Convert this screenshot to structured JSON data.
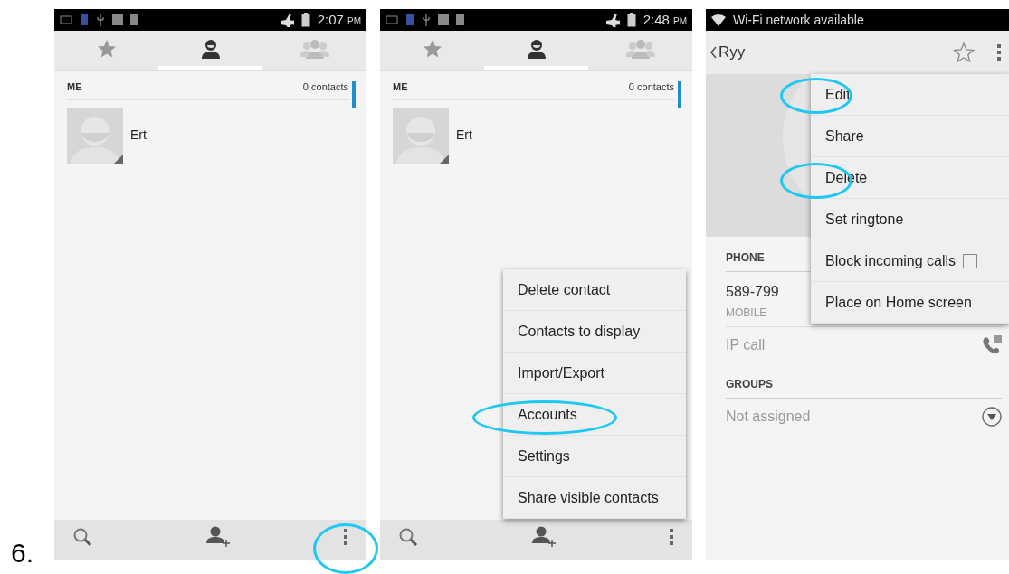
{
  "step_label": "6.",
  "screens": [
    {
      "kind": "contacts",
      "status_bar": {
        "time": "2:07",
        "period": "PM"
      },
      "tabs": [
        {
          "kind": "star",
          "selected": false
        },
        {
          "kind": "person",
          "selected": true
        },
        {
          "kind": "group",
          "selected": false
        }
      ],
      "section": {
        "title": "ME",
        "count": "0 contacts"
      },
      "contacts": [
        {
          "name": "Ert"
        }
      ],
      "bottom_bar": [
        {
          "kind": "search",
          "highlighted": false
        },
        {
          "kind": "add_contact",
          "highlighted": false
        },
        {
          "kind": "more",
          "highlighted": true
        }
      ]
    },
    {
      "kind": "contacts",
      "status_bar": {
        "time": "2:48",
        "period": "PM"
      },
      "tabs": [
        {
          "kind": "star",
          "selected": false
        },
        {
          "kind": "person",
          "selected": true
        },
        {
          "kind": "group",
          "selected": false
        }
      ],
      "section": {
        "title": "ME",
        "count": "0 contacts"
      },
      "contacts": [
        {
          "name": "Ert"
        }
      ],
      "bottom_bar": [
        {
          "kind": "search",
          "highlighted": false
        },
        {
          "kind": "add_contact",
          "highlighted": false
        },
        {
          "kind": "more",
          "highlighted": false
        }
      ],
      "menu": [
        {
          "label": "Delete contact",
          "highlighted": false
        },
        {
          "label": "Contacts to display",
          "highlighted": false
        },
        {
          "label": "Import/Export",
          "highlighted": false
        },
        {
          "label": "Accounts",
          "highlighted": true
        },
        {
          "label": "Settings",
          "highlighted": false
        },
        {
          "label": "Share visible contacts",
          "highlighted": false
        }
      ]
    },
    {
      "kind": "detail",
      "status_bar": {
        "notification": "Wi-Fi network available"
      },
      "title": "Ryy",
      "phone_section": {
        "title": "PHONE",
        "number": "589-799",
        "type": "MOBILE"
      },
      "ip_call": "IP call",
      "groups_section": {
        "title": "GROUPS",
        "value": "Not assigned"
      },
      "menu": [
        {
          "kind": "plain",
          "label": "Edit",
          "highlighted": true
        },
        {
          "kind": "plain",
          "label": "Share",
          "highlighted": false
        },
        {
          "kind": "plain",
          "label": "Delete",
          "highlighted": true
        },
        {
          "kind": "plain",
          "label": "Set ringtone",
          "highlighted": false
        },
        {
          "kind": "checkbox",
          "label": "Block incoming calls",
          "checked": false,
          "highlighted": false
        },
        {
          "kind": "plain",
          "label": "Place on Home screen",
          "highlighted": false
        }
      ]
    }
  ]
}
